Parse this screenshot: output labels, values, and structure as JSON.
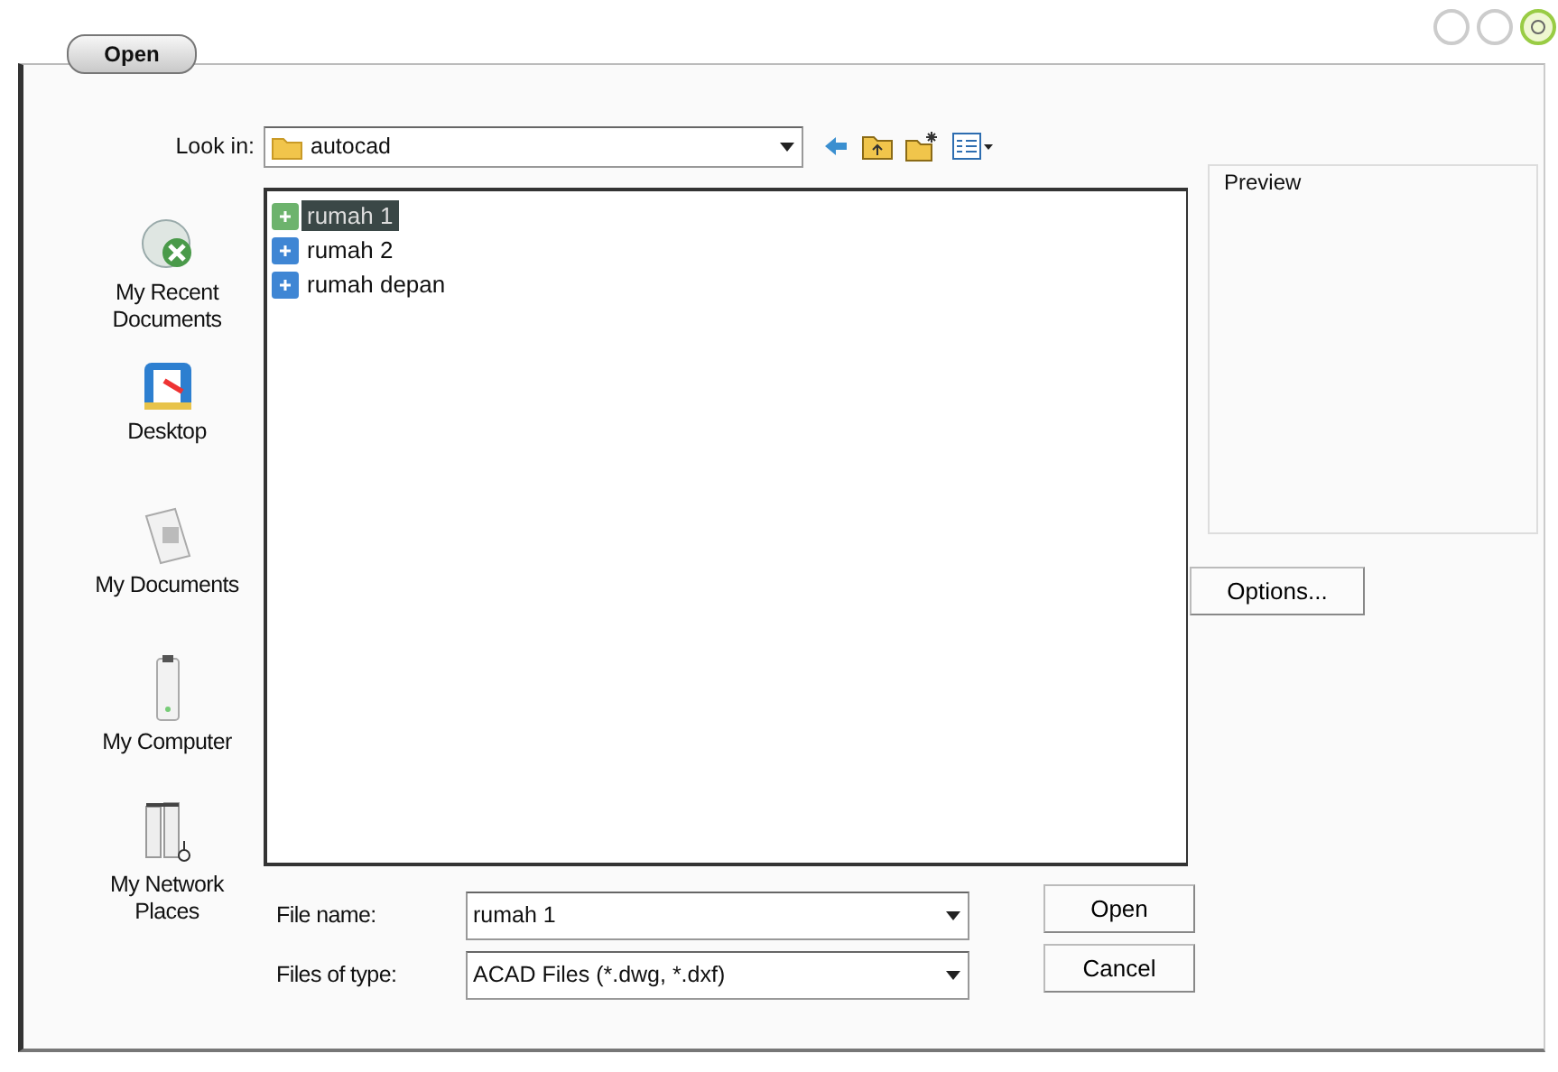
{
  "window": {
    "title": "Open"
  },
  "look_in": {
    "label": "Look in:",
    "value": "autocad"
  },
  "places": [
    {
      "kind": "recent",
      "label": "My Recent Documents"
    },
    {
      "kind": "desktop",
      "label": "Desktop"
    },
    {
      "kind": "documents",
      "label": "My Documents"
    },
    {
      "kind": "computer",
      "label": "My Computer"
    },
    {
      "kind": "network",
      "label": "My Network Places"
    }
  ],
  "files": [
    {
      "name": "rumah 1",
      "selected": true
    },
    {
      "name": "rumah 2",
      "selected": false
    },
    {
      "name": "rumah depan",
      "selected": false
    }
  ],
  "preview": {
    "label": "Preview"
  },
  "options_button": "Options...",
  "file_name": {
    "label": "File name:",
    "value": "rumah 1"
  },
  "file_type": {
    "label": "Files of type:",
    "value": "ACAD Files (*.dwg, *.dxf)"
  },
  "buttons": [
    "Open",
    "Cancel"
  ]
}
